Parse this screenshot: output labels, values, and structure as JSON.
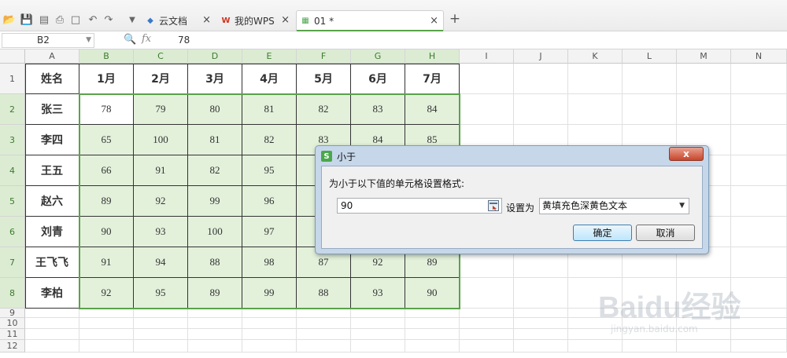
{
  "tabs": [
    {
      "label": "云文档",
      "icon": "cloud-doc-icon"
    },
    {
      "label": "我的WPS",
      "icon": "wps-logo-icon"
    },
    {
      "label": "01 *",
      "icon": "spreadsheet-file-icon"
    }
  ],
  "formula_bar": {
    "cell_ref": "B2",
    "fx": "fx",
    "value": "78"
  },
  "columns": [
    "A",
    "B",
    "C",
    "D",
    "E",
    "F",
    "G",
    "H",
    "I",
    "J",
    "K",
    "L",
    "M",
    "N"
  ],
  "rows": [
    "1",
    "2",
    "3",
    "4",
    "5",
    "6",
    "7",
    "8",
    "9",
    "10",
    "11",
    "12"
  ],
  "table": {
    "header": [
      "姓名",
      "1月",
      "2月",
      "3月",
      "4月",
      "5月",
      "6月",
      "7月"
    ],
    "body": [
      [
        "张三",
        "78",
        "79",
        "80",
        "81",
        "82",
        "83",
        "84"
      ],
      [
        "李四",
        "65",
        "100",
        "81",
        "82",
        "83",
        "84",
        "85"
      ],
      [
        "王五",
        "66",
        "91",
        "82",
        "95",
        "",
        "",
        ""
      ],
      [
        "赵六",
        "89",
        "92",
        "99",
        "96",
        "",
        "",
        ""
      ],
      [
        "刘青",
        "90",
        "93",
        "100",
        "97",
        "",
        "",
        ""
      ],
      [
        "王飞飞",
        "91",
        "94",
        "88",
        "98",
        "87",
        "92",
        "89"
      ],
      [
        "李柏",
        "92",
        "95",
        "89",
        "99",
        "88",
        "93",
        "90"
      ]
    ]
  },
  "dialog": {
    "title": "小于",
    "close": "x",
    "prompt": "为小于以下值的单元格设置格式:",
    "value": "90",
    "set_as_label": "设置为",
    "format_option": "黄填充色深黄色文本",
    "ok": "确定",
    "cancel": "取消"
  },
  "watermark": {
    "main": "Baidu经验",
    "sub": "jingyan.baidu.com"
  },
  "colors": {
    "accent": "#5aa34a",
    "selection_fill": "#e3f1db"
  }
}
